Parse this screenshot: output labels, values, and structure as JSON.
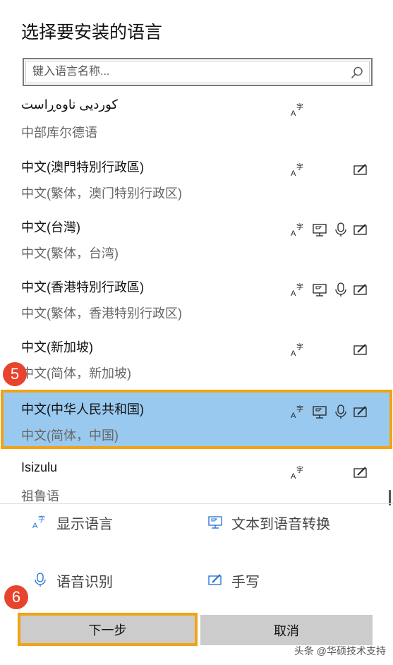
{
  "header": {
    "title": "选择要安装的语言"
  },
  "search": {
    "placeholder": "键入语言名称..."
  },
  "languages": [
    {
      "name": "کوردیی ناوەڕاست",
      "sub": "中部库尔德语",
      "features": [
        "display"
      ]
    },
    {
      "name": "中文(澳門特別行政區)",
      "sub": "中文(繁体，澳门特别行政区)",
      "features": [
        "display",
        "handwriting"
      ]
    },
    {
      "name": "中文(台灣)",
      "sub": "中文(繁体，台湾)",
      "features": [
        "display",
        "tts",
        "speech",
        "handwriting"
      ]
    },
    {
      "name": "中文(香港特別行政區)",
      "sub": "中文(繁体，香港特别行政区)",
      "features": [
        "display",
        "tts",
        "speech",
        "handwriting"
      ]
    },
    {
      "name": "中文(新加坡)",
      "sub": "中文(简体，新加坡)",
      "features": [
        "display",
        "handwriting"
      ]
    },
    {
      "name": "中文(中华人民共和国)",
      "sub": "中文(简体，中国)",
      "features": [
        "display",
        "tts",
        "speech",
        "handwriting"
      ],
      "selected": true
    },
    {
      "name": "Isizulu",
      "sub": "祖鲁语",
      "features": [
        "display",
        "handwriting"
      ]
    }
  ],
  "legend": {
    "display": "显示语言",
    "tts": "文本到语音转换",
    "speech": "语音识别",
    "handwriting": "手写"
  },
  "buttons": {
    "next": "下一步",
    "cancel": "取消"
  },
  "steps": {
    "select_step": "5",
    "next_step": "6"
  },
  "watermark": "头条 @华硕技术支持",
  "colors": {
    "selected_bg": "#99c9ef",
    "highlight_border": "#f1a315",
    "badge": "#e7432d",
    "icon_blue": "#1e6fd0"
  }
}
